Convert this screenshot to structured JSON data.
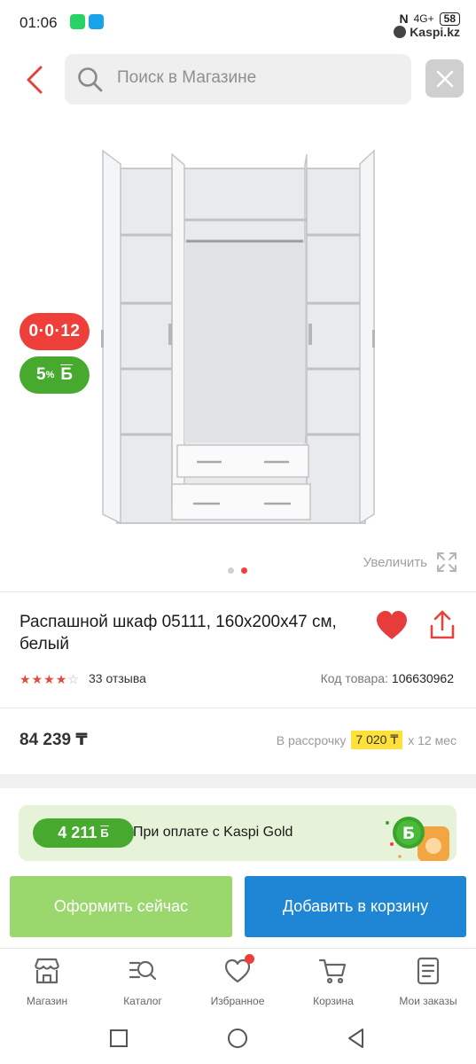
{
  "status_bar": {
    "time": "01:06",
    "signal": "N",
    "network": "4G+",
    "battery": "58",
    "watermark": "Kaspi.kz"
  },
  "header": {
    "search_placeholder": "Поиск в Магазине",
    "back_icon": "chevron-left-icon",
    "close_icon": "close-icon"
  },
  "product": {
    "badge_credit": "0·0·12",
    "badge_bonus_percent": "5",
    "badge_bonus_sup": "%",
    "badge_bonus_letter": "Б",
    "zoom_label": "Увеличить",
    "image_dots": 2,
    "active_dot": 1,
    "title": "Распашной шкаф 05111, 160х200х47 см, белый",
    "rating": 4.5,
    "reviews": "33 отзыва",
    "code_label": "Код товара:",
    "code_value": "106630962",
    "price": "84 239 ₸",
    "installment_prefix": "В рассрочку",
    "installment_amount": "7 020 ₸",
    "installment_suffix": "x 12 мес"
  },
  "gold_banner": {
    "bonus_amount": "4 211",
    "bonus_letter": "Б",
    "text": "При оплате с Kaspi Gold"
  },
  "actions": {
    "buy_now": "Оформить сейчас",
    "add_to_cart": "Добавить в корзину"
  },
  "tabs": [
    {
      "label": "Магазин",
      "icon": "store-icon"
    },
    {
      "label": "Каталог",
      "icon": "catalog-search-icon"
    },
    {
      "label": "Избранное",
      "icon": "heart-icon"
    },
    {
      "label": "Корзина",
      "icon": "cart-icon"
    },
    {
      "label": "Мои заказы",
      "icon": "orders-icon"
    }
  ],
  "colors": {
    "accent_red": "#ef3f3a",
    "bonus_green": "#47a92e",
    "buy_green": "#9ad86d",
    "cart_blue": "#1f86d6",
    "installment_yellow": "#ffe13a"
  }
}
